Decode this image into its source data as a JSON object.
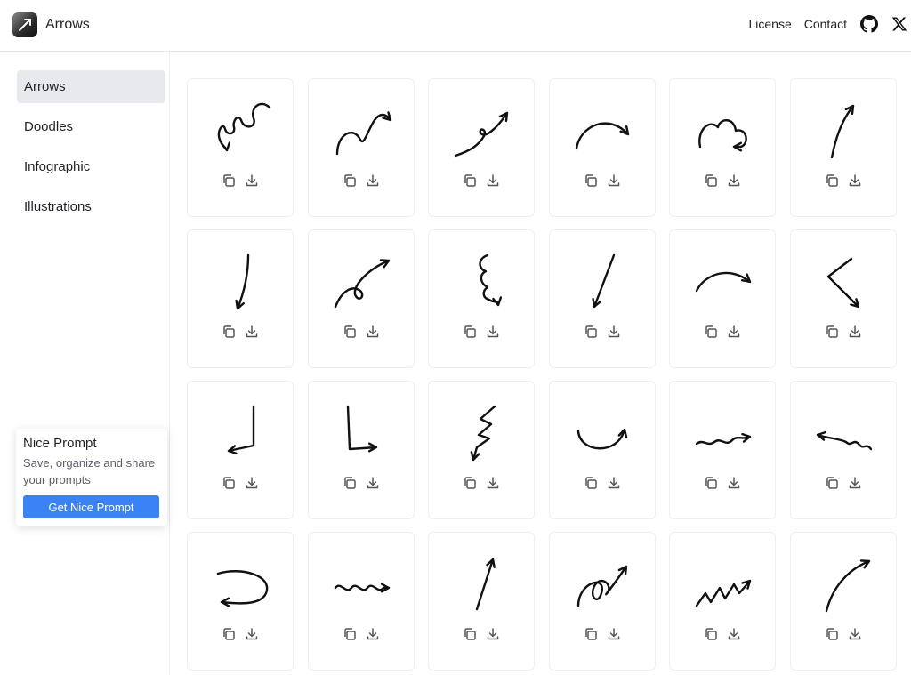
{
  "app": {
    "title": "Arrows"
  },
  "header": {
    "links": [
      {
        "label": "License"
      },
      {
        "label": "Contact"
      }
    ],
    "icons": [
      "github-icon",
      "x-logo-icon"
    ]
  },
  "sidebar": {
    "items": [
      {
        "label": "Arrows",
        "active": true
      },
      {
        "label": "Doodles",
        "active": false
      },
      {
        "label": "Infographic",
        "active": false
      },
      {
        "label": "Illustrations",
        "active": false
      }
    ],
    "promo": {
      "title": "Nice Prompt",
      "text": "Save, organize and share your prompts",
      "button_label": "Get Nice Prompt",
      "button_color": "#3b82f6"
    }
  },
  "grid": {
    "card_actions": [
      "copy-icon",
      "download-icon"
    ],
    "cards": [
      {
        "art": "spiral-loop-arrow"
      },
      {
        "art": "wave-curve-arrow"
      },
      {
        "art": "loop-swoosh-arrow"
      },
      {
        "art": "arc-right-arrow"
      },
      {
        "art": "cloud-bump-arrow"
      },
      {
        "art": "thin-up-arrow"
      },
      {
        "art": "thin-down-arrow"
      },
      {
        "art": "loop-up-arrow"
      },
      {
        "art": "squiggle-down-arrow"
      },
      {
        "art": "bold-down-arrow"
      },
      {
        "art": "arc-short-right-arrow"
      },
      {
        "art": "zigzag-down-right-arrow"
      },
      {
        "art": "corner-down-left-arrow"
      },
      {
        "art": "corner-down-right-arrow"
      },
      {
        "art": "zigzag-vertical-arrow"
      },
      {
        "art": "u-turn-up-arrow"
      },
      {
        "art": "wavy-right-arrow"
      },
      {
        "art": "wavy-left-arrow"
      },
      {
        "art": "round-loop-left-arrow"
      },
      {
        "art": "wiggle-right-arrow"
      },
      {
        "art": "straight-up-arrow"
      },
      {
        "art": "multi-loop-up-arrow"
      },
      {
        "art": "zigzag-ribbon-arrow"
      },
      {
        "art": "curve-up-right-arrow"
      }
    ]
  }
}
